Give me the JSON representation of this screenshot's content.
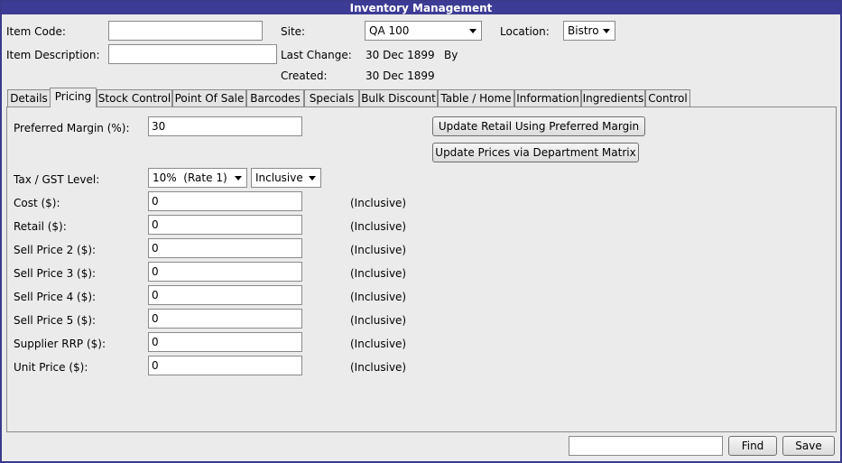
{
  "window": {
    "title": "Inventory Management"
  },
  "header": {
    "item_code_label": "Item Code:",
    "item_code_value": "",
    "item_description_label": "Item Description:",
    "item_description_value": "",
    "site_label": "Site:",
    "site_value": "QA 100",
    "location_label": "Location:",
    "location_value": "Bistro",
    "last_change_label": "Last Change:",
    "last_change_value": "30 Dec 1899",
    "by_label": "By",
    "created_label": "Created:",
    "created_value": "30 Dec 1899"
  },
  "tabs": [
    {
      "label": "Details"
    },
    {
      "label": "Pricing",
      "active": true
    },
    {
      "label": "Stock Control"
    },
    {
      "label": "Point Of Sale"
    },
    {
      "label": "Barcodes"
    },
    {
      "label": "Specials"
    },
    {
      "label": "Bulk Discount"
    },
    {
      "label": "Table / Home"
    },
    {
      "label": "Information"
    },
    {
      "label": "Ingredients"
    },
    {
      "label": "Control"
    }
  ],
  "pricing": {
    "preferred_margin_label": "Preferred Margin (%):",
    "preferred_margin_value": "30",
    "update_retail_button": "Update Retail Using Preferred Margin",
    "update_prices_button": "Update Prices via Department Matrix",
    "tax_label": "Tax / GST Level:",
    "tax_value": "10%  (Rate 1)",
    "tax_mode_value": "Inclusive",
    "rows": [
      {
        "label": "Cost ($):",
        "value": "0",
        "note": "(Inclusive)"
      },
      {
        "label": "Retail ($):",
        "value": "0",
        "note": "(Inclusive)"
      },
      {
        "label": "Sell Price 2 ($):",
        "value": "0",
        "note": "(Inclusive)"
      },
      {
        "label": "Sell Price 3 ($):",
        "value": "0",
        "note": "(Inclusive)"
      },
      {
        "label": "Sell Price 4 ($):",
        "value": "0",
        "note": "(Inclusive)"
      },
      {
        "label": "Sell Price 5 ($):",
        "value": "0",
        "note": "(Inclusive)"
      },
      {
        "label": "Supplier RRP ($):",
        "value": "0",
        "note": "(Inclusive)"
      },
      {
        "label": "Unit Price ($):",
        "value": "0",
        "note": "(Inclusive)"
      }
    ]
  },
  "footer": {
    "find_input_value": "",
    "find_button": "Find",
    "save_button": "Save"
  },
  "colors": {
    "titlebar": "#3c3c96",
    "background": "#ebebeb"
  }
}
